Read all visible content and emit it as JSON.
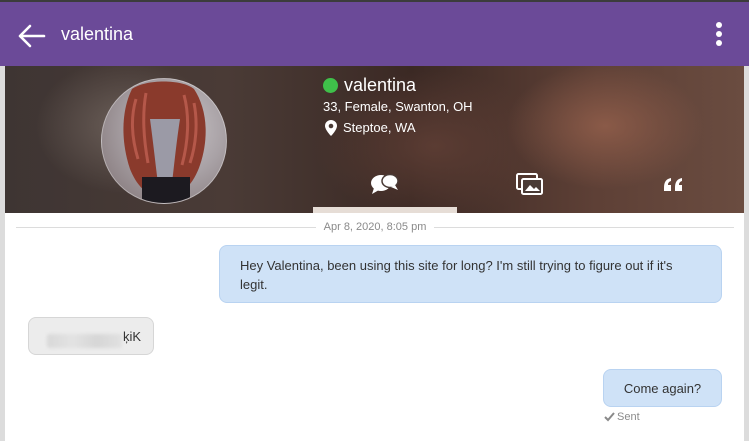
{
  "appbar": {
    "title": "valentina",
    "bg_color": "#6b4a98",
    "back_icon": "arrow-left-icon",
    "menu_icon": "more-vertical-icon"
  },
  "profile": {
    "name": "valentina",
    "online_status_color": "#3fc04a",
    "details": "33, Female, Swanton, OH",
    "location": "Steptoe, WA",
    "tabs": [
      {
        "id": "chat",
        "icon": "chat-bubbles-icon",
        "active": true
      },
      {
        "id": "photos",
        "icon": "photos-icon",
        "active": false
      },
      {
        "id": "quotes",
        "icon": "quote-icon",
        "active": false
      }
    ]
  },
  "conversation": {
    "date_separator": "Apr 8, 2020, 8:05 pm",
    "messages": [
      {
        "direction": "outgoing",
        "text": "Hey Valentina, been using this site for long? I'm still trying to figure out if it's legit."
      },
      {
        "direction": "incoming",
        "text": "ķiK",
        "redacted_prefix": true
      },
      {
        "direction": "outgoing",
        "text": "Come again?",
        "status": "Sent"
      }
    ]
  },
  "colors": {
    "outgoing_bubble": "#cfe2f7",
    "incoming_bubble": "#ececec"
  }
}
